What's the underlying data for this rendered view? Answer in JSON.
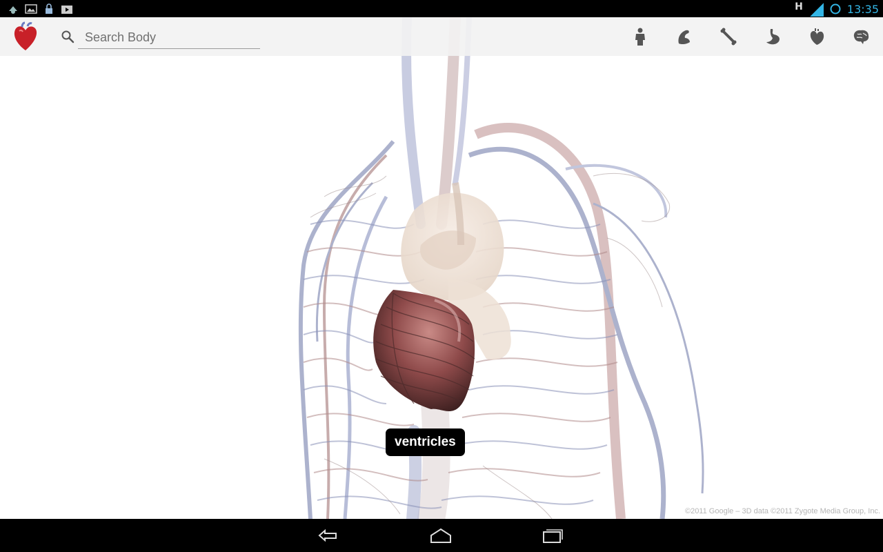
{
  "status_bar": {
    "time": "13:35",
    "network_type": "H",
    "icons": [
      "usb-debug-icon",
      "image-icon",
      "lock-icon",
      "media-icon",
      "signal-icon",
      "sync-icon"
    ]
  },
  "action_bar": {
    "app_icon": "heart-app-icon",
    "search": {
      "placeholder": "Search Body",
      "value": ""
    },
    "layers": [
      {
        "name": "skin-layer",
        "icon": "body-icon"
      },
      {
        "name": "muscle-layer",
        "icon": "muscle-icon"
      },
      {
        "name": "skeleton-layer",
        "icon": "bone-icon"
      },
      {
        "name": "organs-layer",
        "icon": "stomach-icon"
      },
      {
        "name": "circulatory-layer",
        "icon": "heart-icon"
      },
      {
        "name": "nervous-layer",
        "icon": "brain-icon"
      }
    ]
  },
  "viewport": {
    "tooltip": "ventricles",
    "copyright": "©2011 Google – 3D data ©2011 Zygote Media Group, Inc."
  },
  "nav_bar": {
    "buttons": [
      "back-icon",
      "home-icon",
      "recent-apps-icon"
    ]
  },
  "colors": {
    "accent": "#33b5e5",
    "vein": "#8a92b8",
    "artery": "#b08a8a",
    "heart": "#8c3c3c"
  }
}
